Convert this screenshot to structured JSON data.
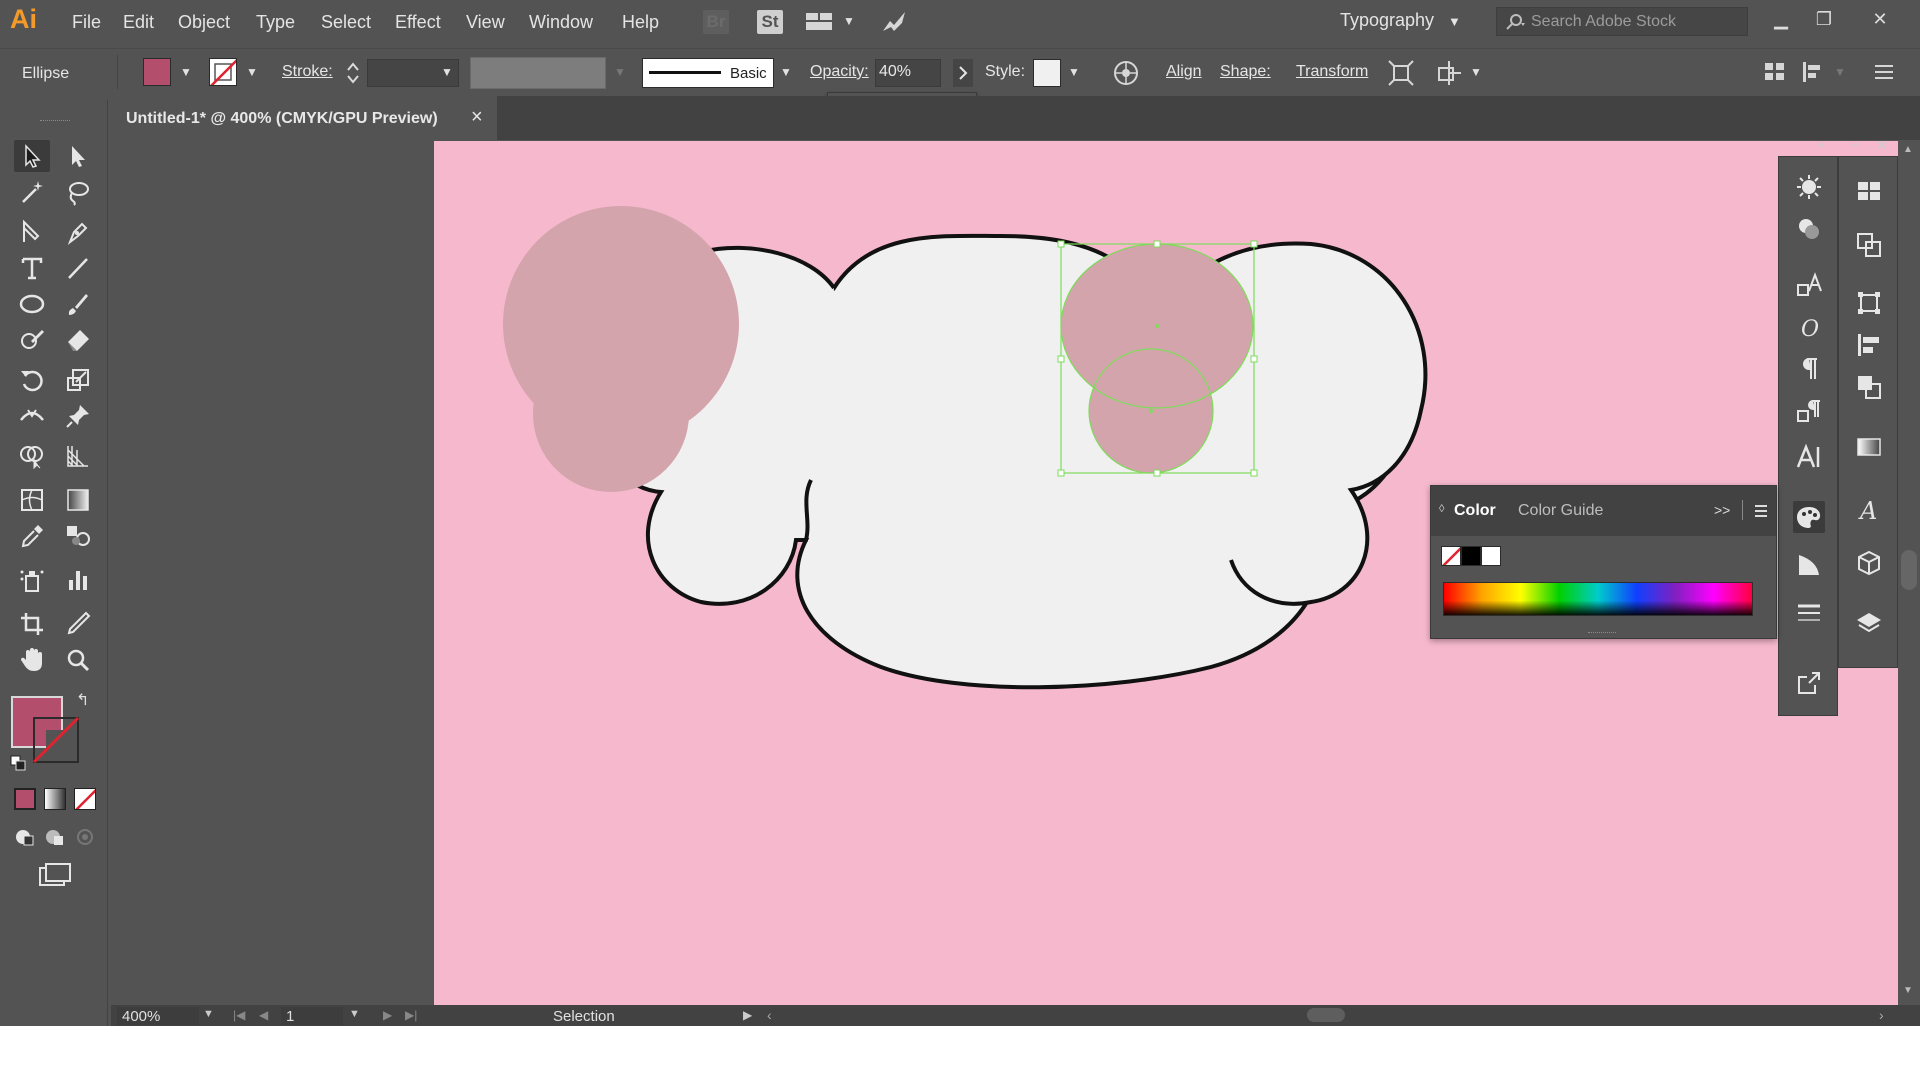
{
  "app": {
    "logo": "Ai",
    "menu": [
      "File",
      "Edit",
      "Object",
      "Type",
      "Select",
      "Effect",
      "View",
      "Window",
      "Help"
    ],
    "bridge_label": "Br",
    "stock_label": "St",
    "workspace": "Typography",
    "search_placeholder": "Search Adobe Stock"
  },
  "control_bar": {
    "object_type": "Ellipse",
    "fill_color": "#b34e6c",
    "stroke_label": "Stroke:",
    "brush_label": "Basic",
    "opacity_label": "Opacity:",
    "opacity_value": "40%",
    "opacity_slider_fraction": 0.4,
    "style_label": "Style:",
    "align_label": "Align",
    "shape_label": "Shape:",
    "transform_label": "Transform"
  },
  "document": {
    "tab_title": "Untitled-1* @ 400% (CMYK/GPU Preview)",
    "close_glyph": "×"
  },
  "status_bar": {
    "zoom": "400%",
    "artboard_number": "1",
    "status": "Selection"
  },
  "color_panel": {
    "tabs": [
      "Color",
      "Color Guide"
    ],
    "active_tab": "Color",
    "expand_glyph": ">>",
    "swatches": [
      "none",
      "#000000",
      "#ffffff"
    ]
  },
  "colors": {
    "artboard": "#f6b8cd",
    "shape_fill": "#f0f0f0",
    "ear_fill": "#d4a4ad",
    "selection": "#7ddc5a",
    "fill_swatch": "#b34e6c"
  },
  "toolbar": {
    "tools": [
      "selection-tool",
      "direct-selection-tool",
      "magic-wand-tool",
      "lasso-tool",
      "pen-tool",
      "curvature-tool",
      "type-tool",
      "line-segment-tool",
      "ellipse-tool",
      "paintbrush-tool",
      "shaper-tool",
      "eraser-tool",
      "rotate-tool",
      "scale-tool",
      "width-tool",
      "puppet-warp-tool",
      "shape-builder-tool",
      "perspective-grid-tool",
      "mesh-tool",
      "gradient-tool",
      "eyedropper-tool",
      "blend-tool",
      "symbol-sprayer-tool",
      "column-graph-tool",
      "artboard-tool",
      "slice-tool",
      "hand-tool",
      "zoom-tool"
    ]
  }
}
